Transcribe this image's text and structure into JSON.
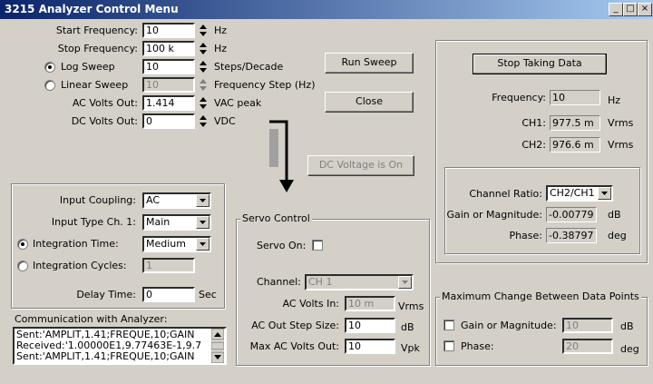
{
  "window": {
    "title": "3215 Analyzer Control Menu",
    "min": "_",
    "max": "□",
    "close": "×"
  },
  "sweep": {
    "start_label": "Start Frequency:",
    "start_value": "10",
    "start_unit": "Hz",
    "stop_label": "Stop Frequency:",
    "stop_value": "100 k",
    "stop_unit": "Hz",
    "log_label": "Log Sweep",
    "log_value": "10",
    "log_unit": "Steps/Decade",
    "linear_label": "Linear Sweep",
    "linear_value": "10",
    "linear_unit": "Frequency Step (Hz)",
    "acv_label": "AC Volts Out:",
    "acv_value": "1.414",
    "acv_unit": "VAC peak",
    "dcv_label": "DC Volts Out:",
    "dcv_value": "0",
    "dcv_unit": "VDC"
  },
  "buttons": {
    "run": "Run Sweep",
    "close": "Close",
    "dc": "DC Voltage is On",
    "stop": "Stop Taking Data"
  },
  "input": {
    "coupling_label": "Input Coupling:",
    "coupling_value": "AC",
    "type_label": "Input Type Ch. 1:",
    "type_value": "Main",
    "integ_time_label": "Integration Time:",
    "integ_time_value": "Medium",
    "integ_cycles_label": "Integration Cycles:",
    "integ_cycles_value": "1",
    "delay_label": "Delay Time:",
    "delay_value": "0",
    "delay_unit": "Sec"
  },
  "comm": {
    "label": "Communication with Analyzer:",
    "lines": [
      "Sent:'AMPLIT,1.41;FREQUE,10;GAIN",
      "Received:'1.00000E1,9.77463E-1,9.7",
      "Sent:'AMPLIT,1.41;FREQUE,10;GAIN"
    ]
  },
  "servo": {
    "title": "Servo Control",
    "on_label": "Servo On:",
    "channel_label": "Channel:",
    "channel_value": "CH 1",
    "acin_label": "AC Volts In:",
    "acin_value": "10 m",
    "acin_unit": "Vrms",
    "step_label": "AC Out Step Size:",
    "step_value": "10",
    "step_unit": "dB",
    "max_label": "Max AC Volts Out:",
    "max_value": "10",
    "max_unit": "Vpk"
  },
  "readout": {
    "freq_label": "Frequency:",
    "freq_value": "10",
    "freq_unit": "Hz",
    "ch1_label": "CH1:",
    "ch1_value": "977.5 m",
    "ch1_unit": "Vrms",
    "ch2_label": "CH2:",
    "ch2_value": "976.6 m",
    "ch2_unit": "Vrms"
  },
  "ratio": {
    "channel_label": "Channel Ratio:",
    "channel_value": "CH2/CH1",
    "gain_label": "Gain or Magnitude:",
    "gain_value": "-0.00779",
    "gain_unit": "dB",
    "phase_label": "Phase:",
    "phase_value": "-0.38797",
    "phase_unit": "deg"
  },
  "maxchange": {
    "title": "Maximum Change Between Data Points",
    "gain_label": "Gain or Magnitude:",
    "gain_value": "10",
    "gain_unit": "dB",
    "phase_label": "Phase:",
    "phase_value": "20",
    "phase_unit": "deg"
  }
}
